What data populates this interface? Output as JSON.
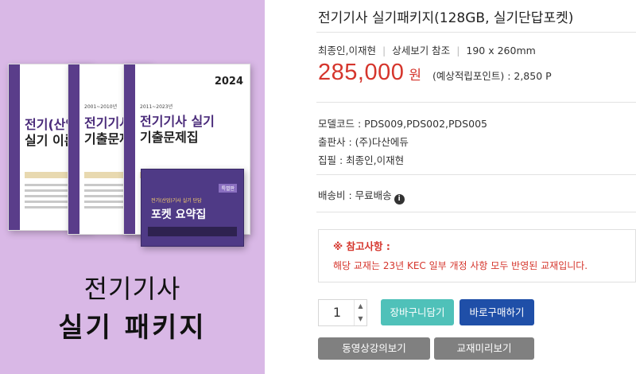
{
  "product": {
    "title": "전기기사 실기패키지(128GB, 실기단답포켓)",
    "authors": "최종인,이재현",
    "detail_link": "상세보기 참조",
    "size": "190 x 260mm",
    "price": "285,000",
    "currency": "원",
    "points": "(예상적립포인트) : 2,850 P",
    "model_code": "모델코드 : PDS009,PDS002,PDS005",
    "publisher": "출판사 : (주)다산에듀",
    "writers": "집필 : 최종인,이재현",
    "shipping": "배송비 : 무료배송",
    "shipping_icon": "info-icon"
  },
  "notice": {
    "heading": "※ 참고사항 :",
    "text": "해당 교재는 23년 KEC 일부 개정 사항 모두 반영된 교재입니다."
  },
  "order": {
    "quantity": "1",
    "up_icon": "^",
    "down_icon": "v",
    "cart_label": "장바구니담기",
    "buy_label": "바로구매하기",
    "video_label": "동영상강의보기",
    "preview_label": "교재미리보기"
  },
  "cover": {
    "title_line1": "전기기사",
    "title_line2": "실기 패키지",
    "book1": {
      "title1": "전기(산업",
      "title2": "실기 이론"
    },
    "book2": {
      "label": "2001~2010년",
      "title1": "전기기사 실",
      "title2": "기출문제"
    },
    "book3": {
      "year": "2024",
      "label": "2011~2023년",
      "title1": "전기기사 실기",
      "title2": "기출문제집"
    },
    "pocket": {
      "tag": "특별판",
      "subtitle": "전기(산업)기사 실기 단답",
      "title": "포켓 요약집"
    },
    "accent": "#5a3d8a",
    "background": "#d9b8e6"
  },
  "colors": {
    "price": "#d5352c",
    "cart_button": "#4fc1b9",
    "buy_button": "#1f4fa8",
    "gray_button": "#808080"
  }
}
